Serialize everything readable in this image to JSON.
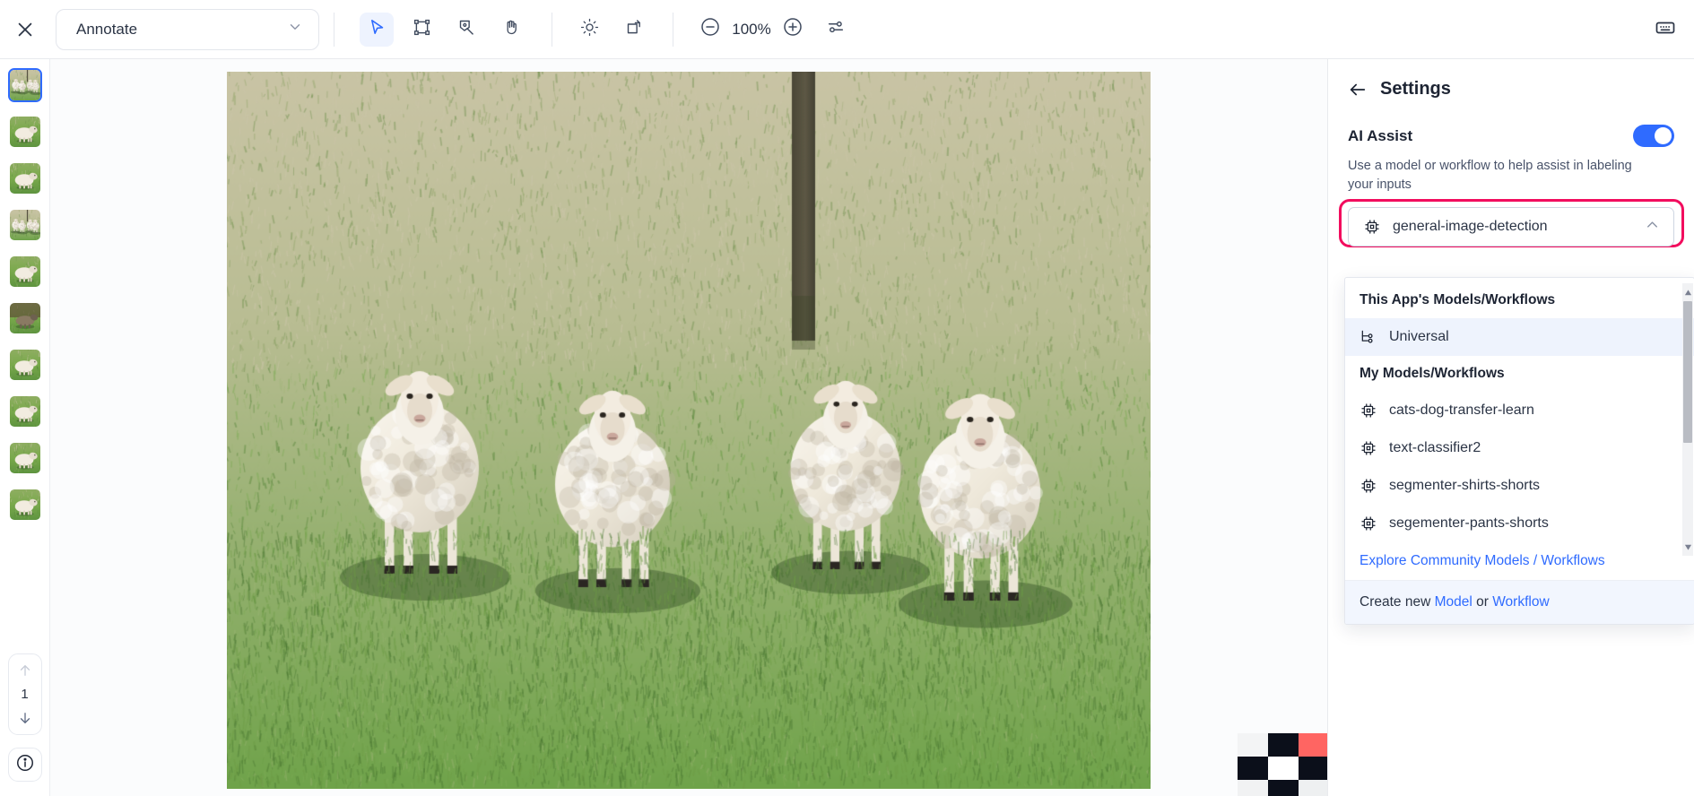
{
  "toolbar": {
    "close_label": "close-icon",
    "mode": {
      "value": "Annotate",
      "chevron": "chevron-down-icon"
    },
    "tools": [
      {
        "name": "select-tool",
        "icon": "cursor-arrow-icon",
        "active": true
      },
      {
        "name": "bounding-box-tool",
        "icon": "bounding-box-icon",
        "active": false
      },
      {
        "name": "polygon-tool",
        "icon": "polygon-pen-icon",
        "active": false
      },
      {
        "name": "pan-tool",
        "icon": "hand-icon",
        "active": false
      }
    ],
    "adjust_tools": [
      {
        "name": "brightness-tool",
        "icon": "sun-icon"
      },
      {
        "name": "rotate-tool",
        "icon": "rotate-icon"
      }
    ],
    "zoom": {
      "out": "minus-circle-icon",
      "value": "100%",
      "in": "plus-circle-icon"
    },
    "settings_sliders": "sliders-icon",
    "keyboard_shortcuts": "keyboard-icon"
  },
  "rail": {
    "thumbnails": [
      {
        "label": "thumbnail-1-four-sheep-field",
        "selected": true
      },
      {
        "label": "thumbnail-2-lamb-standing",
        "selected": false
      },
      {
        "label": "thumbnail-3-white-sheep-grass",
        "selected": false
      },
      {
        "label": "thumbnail-4-sheep-group-pole",
        "selected": false
      },
      {
        "label": "thumbnail-5-sheep-pasture",
        "selected": false
      },
      {
        "label": "thumbnail-6-goat-brown",
        "selected": false
      },
      {
        "label": "thumbnail-7-sheep-white-field",
        "selected": false
      },
      {
        "label": "thumbnail-8-goat-head",
        "selected": false
      },
      {
        "label": "thumbnail-9-sheep-side",
        "selected": false
      },
      {
        "label": "thumbnail-10-goat-portrait",
        "selected": false
      }
    ],
    "pager": {
      "up": "arrow-up-icon",
      "page": "1",
      "down": "arrow-down-icon"
    },
    "info": "info-circle-icon"
  },
  "canvas": {
    "image_alt": "four-sheep-standing-in-grassy-field",
    "minimap": "checkerboard-minimap"
  },
  "panel": {
    "back_icon": "arrow-left-icon",
    "title": "Settings",
    "ai_assist": {
      "label": "AI Assist",
      "enabled": true,
      "helper": "Use a model or workflow to help assist in labeling your inputs"
    },
    "model_select": {
      "icon": "chip-icon",
      "value": "general-image-detection",
      "chevron": "chevron-up-icon",
      "highlight_color": "#f20d5e"
    },
    "dropdown": {
      "groups": [
        {
          "title": "This App's Models/Workflows",
          "items": [
            {
              "label": "Universal",
              "icon": "workflow-icon",
              "selected": true
            }
          ]
        },
        {
          "title": "My Models/Workflows",
          "items": [
            {
              "label": "cats-dog-transfer-learn",
              "icon": "chip-icon",
              "selected": false
            },
            {
              "label": "text-classifier2",
              "icon": "chip-icon",
              "selected": false
            },
            {
              "label": "segmenter-shirts-shorts",
              "icon": "chip-icon",
              "selected": false
            },
            {
              "label": "segementer-pants-shorts",
              "icon": "chip-icon",
              "selected": false
            }
          ]
        }
      ],
      "explore_link": "Explore Community Models / Workflows",
      "create": {
        "prefix": "Create new ",
        "model_link": "Model",
        "middle": " or ",
        "workflow_link": "Workflow"
      }
    }
  },
  "colors": {
    "accent": "#2f6bff",
    "highlight": "#f20d5e",
    "text": "#1d2433",
    "muted": "#49536a"
  }
}
